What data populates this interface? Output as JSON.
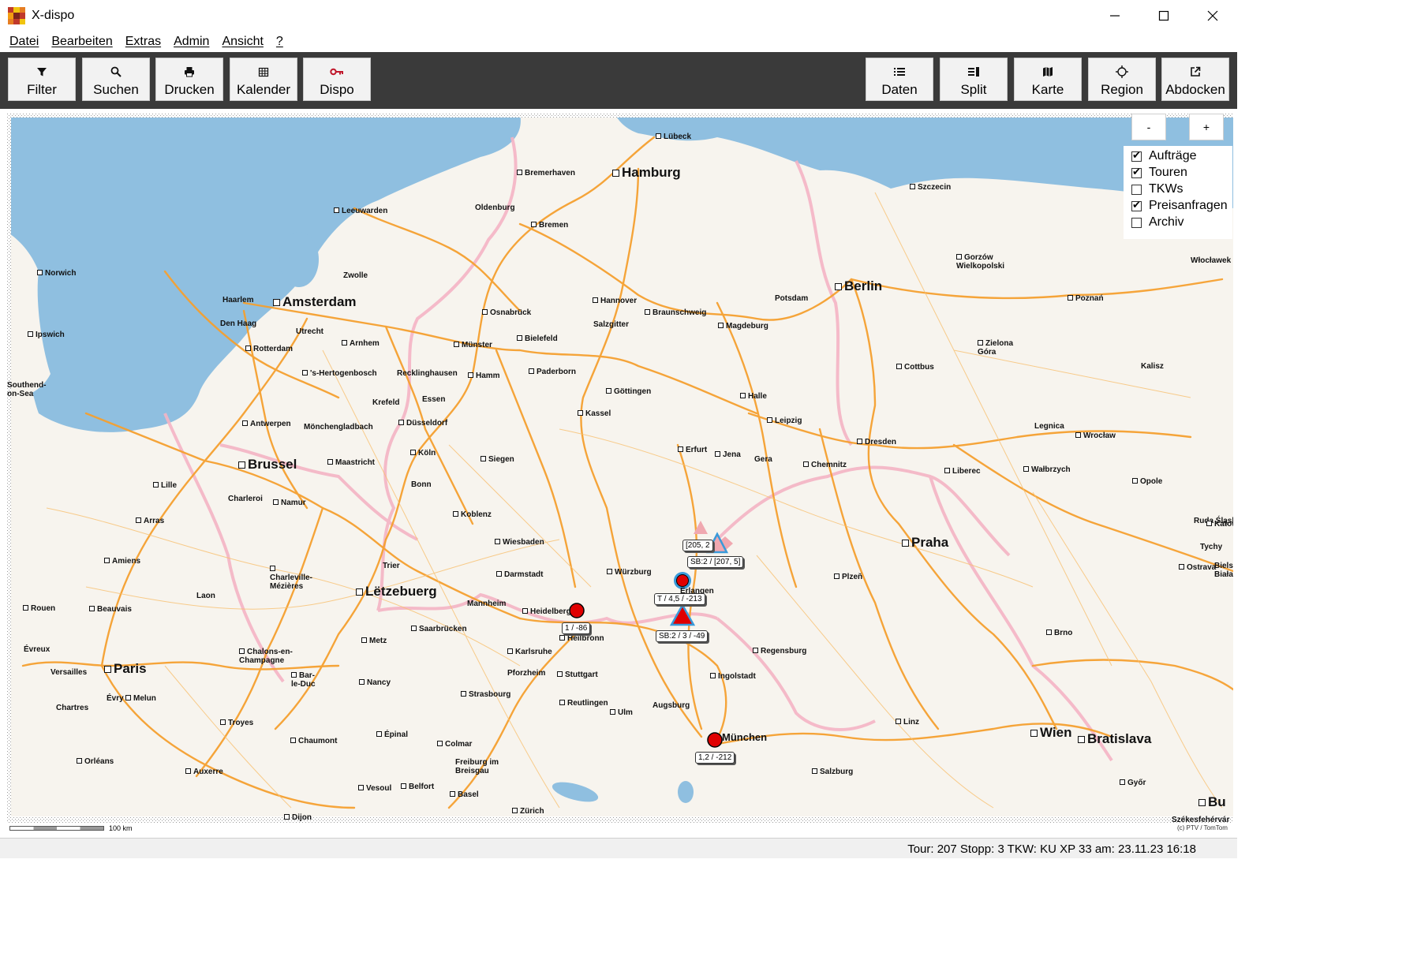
{
  "window": {
    "title": "X-dispo"
  },
  "menu": [
    {
      "label": "Datei"
    },
    {
      "label": "Bearbeiten"
    },
    {
      "label": "Extras"
    },
    {
      "label": "Admin"
    },
    {
      "label": "Ansicht"
    },
    {
      "label": "?"
    }
  ],
  "toolbar": {
    "left": [
      {
        "label": "Filter",
        "icon": "filter-icon"
      },
      {
        "label": "Suchen",
        "icon": "search-icon"
      },
      {
        "label": "Drucken",
        "icon": "printer-icon"
      },
      {
        "label": "Kalender",
        "icon": "calendar-icon"
      },
      {
        "label": "Dispo",
        "icon": "key-icon"
      }
    ],
    "right": [
      {
        "label": "Daten",
        "icon": "list-icon"
      },
      {
        "label": "Split",
        "icon": "split-icon"
      },
      {
        "label": "Karte",
        "icon": "map-icon"
      },
      {
        "label": "Region",
        "icon": "crosshair-icon"
      },
      {
        "label": "Abdocken",
        "icon": "external-window-icon"
      }
    ]
  },
  "map": {
    "zoom_out_label": "-",
    "zoom_in_label": "+",
    "layers": [
      {
        "label": "Aufträge",
        "checked": true
      },
      {
        "label": "Touren",
        "checked": true
      },
      {
        "label": "TKWs",
        "checked": false
      },
      {
        "label": "Preisanfragen",
        "checked": true
      },
      {
        "label": "Archiv",
        "checked": false
      }
    ],
    "scale_label": "100 km",
    "copyright": "(c) PTV / TomTom",
    "colors": {
      "water": "#8fbfe0",
      "land": "#f7f4ee",
      "motorway": "#f5a030",
      "border": "#f4b4c4",
      "marker_order": "#e00000",
      "marker_tour": "#3a9ad9",
      "marker_request": "#f0a8b0"
    },
    "cities": [
      {
        "name": "Lübeck"
      },
      {
        "name": "Hamburg"
      },
      {
        "name": "Bremerhaven"
      },
      {
        "name": "Szczecin"
      },
      {
        "name": "Leeuwarden"
      },
      {
        "name": "Oldenburg"
      },
      {
        "name": "Bremen"
      },
      {
        "name": "Norwich"
      },
      {
        "name": "Zwolle"
      },
      {
        "name": "Berlin"
      },
      {
        "name": "Gorzów Wielkopolski"
      },
      {
        "name": "Włocławek"
      },
      {
        "name": "Haarlem"
      },
      {
        "name": "Amsterdam"
      },
      {
        "name": "Hannover"
      },
      {
        "name": "Potsdam"
      },
      {
        "name": "Poznań"
      },
      {
        "name": "Den Haag"
      },
      {
        "name": "Utrecht"
      },
      {
        "name": "Osnabrück"
      },
      {
        "name": "Braunschweig"
      },
      {
        "name": "Salzgitter"
      },
      {
        "name": "Magdeburg"
      },
      {
        "name": "Ipswich"
      },
      {
        "name": "Arnhem"
      },
      {
        "name": "Rotterdam"
      },
      {
        "name": "Bielefeld"
      },
      {
        "name": "Münster"
      },
      {
        "name": "Zielona Góra"
      },
      {
        "name": "'s-Hertogenbosch"
      },
      {
        "name": "Recklinghausen"
      },
      {
        "name": "Hamm"
      },
      {
        "name": "Paderborn"
      },
      {
        "name": "Cottbus"
      },
      {
        "name": "Kalisz"
      },
      {
        "name": "Southend-on-Sea"
      },
      {
        "name": "Göttingen"
      },
      {
        "name": "Halle"
      },
      {
        "name": "Krefeld"
      },
      {
        "name": "Essen"
      },
      {
        "name": "Kassel"
      },
      {
        "name": "Leipzig"
      },
      {
        "name": "Antwerpen"
      },
      {
        "name": "Mönchengladbach"
      },
      {
        "name": "Düsseldorf"
      },
      {
        "name": "Legnica"
      },
      {
        "name": "Dresden"
      },
      {
        "name": "Wrocław"
      },
      {
        "name": "Erfurt"
      },
      {
        "name": "Jena"
      },
      {
        "name": "Köln"
      },
      {
        "name": "Brussel"
      },
      {
        "name": "Maastricht"
      },
      {
        "name": "Siegen"
      },
      {
        "name": "Gera"
      },
      {
        "name": "Chemnitz"
      },
      {
        "name": "Liberec"
      },
      {
        "name": "Wałbrzych"
      },
      {
        "name": "Opole"
      },
      {
        "name": "Bonn"
      },
      {
        "name": "Lille"
      },
      {
        "name": "Charleroi"
      },
      {
        "name": "Namur"
      },
      {
        "name": "Koblenz"
      },
      {
        "name": "Arras"
      },
      {
        "name": "Ruda Śląska"
      },
      {
        "name": "Katowice"
      },
      {
        "name": "Wiesbaden"
      },
      {
        "name": "Praha"
      },
      {
        "name": "Tychy"
      },
      {
        "name": "Amiens"
      },
      {
        "name": "Trier"
      },
      {
        "name": "Darmstadt"
      },
      {
        "name": "Würzburg"
      },
      {
        "name": "Erlangen"
      },
      {
        "name": "Ostrava"
      },
      {
        "name": "Bielsko-Biała"
      },
      {
        "name": "Charleville-Mézières"
      },
      {
        "name": "Plzeň"
      },
      {
        "name": "Laon"
      },
      {
        "name": "Lëtzebuerg"
      },
      {
        "name": "Mannheim"
      },
      {
        "name": "Heidelberg"
      },
      {
        "name": "Rouen"
      },
      {
        "name": "Beauvais"
      },
      {
        "name": "Saarbrücken"
      },
      {
        "name": "Heilbronn"
      },
      {
        "name": "Brno"
      },
      {
        "name": "Metz"
      },
      {
        "name": "Karlsruhe"
      },
      {
        "name": "Regensburg"
      },
      {
        "name": "Évreux"
      },
      {
        "name": "Chalons-en-Champagne"
      },
      {
        "name": "Paris"
      },
      {
        "name": "Versailles"
      },
      {
        "name": "Pforzheim"
      },
      {
        "name": "Stuttgart"
      },
      {
        "name": "Ingolstadt"
      },
      {
        "name": "Nancy"
      },
      {
        "name": "Bar-le-Duc"
      },
      {
        "name": "Évry"
      },
      {
        "name": "Melun"
      },
      {
        "name": "Strasbourg"
      },
      {
        "name": "Reutlingen"
      },
      {
        "name": "Augsburg"
      },
      {
        "name": "Chartres"
      },
      {
        "name": "Ulm"
      },
      {
        "name": "Troyes"
      },
      {
        "name": "Linz"
      },
      {
        "name": "Wien"
      },
      {
        "name": "Bratislava"
      },
      {
        "name": "München"
      },
      {
        "name": "Épinal"
      },
      {
        "name": "Chaumont"
      },
      {
        "name": "Colmar"
      },
      {
        "name": "Orléans"
      },
      {
        "name": "Freiburg im Breisgau"
      },
      {
        "name": "Salzburg"
      },
      {
        "name": "Győr"
      },
      {
        "name": "Auxerre"
      },
      {
        "name": "Vesoul"
      },
      {
        "name": "Belfort"
      },
      {
        "name": "Basel"
      },
      {
        "name": "Bu"
      },
      {
        "name": "Zürich"
      },
      {
        "name": "Székesfehérvár"
      },
      {
        "name": "Dijon"
      }
    ],
    "markers": [
      {
        "label": "[205, 2"
      },
      {
        "label": "SB:2 / [207, 5]"
      },
      {
        "label": "T / 4,5 / -213"
      },
      {
        "label": "SB:2 / 3 / -49"
      },
      {
        "label": "1 / -86"
      },
      {
        "label": "1,2 / -212"
      }
    ]
  },
  "status": {
    "text": "Tour: 207 Stopp: 3 TKW: KU XP 33 am: 23.11.23 16:18"
  }
}
